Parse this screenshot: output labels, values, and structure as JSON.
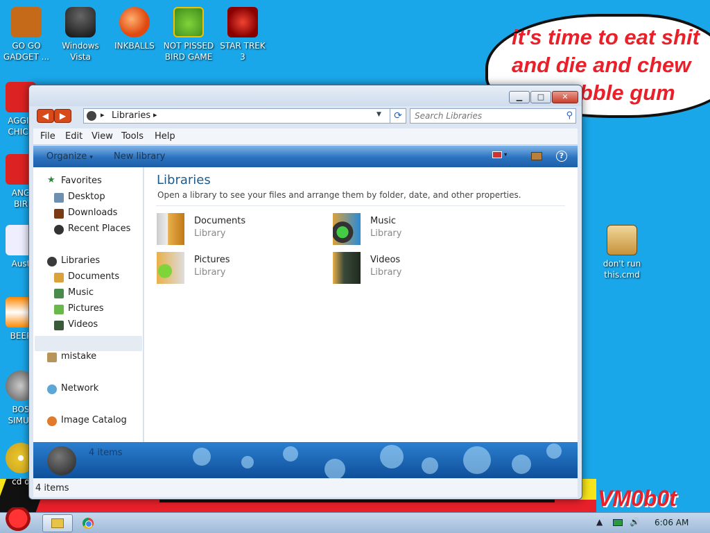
{
  "desktop": {
    "icons_top": [
      {
        "label_1": "GO GO",
        "label_2": "GADGET ...",
        "icon": "briefcase-icon",
        "color": "#c46a18"
      },
      {
        "label_1": "Windows",
        "label_2": "Vista",
        "icon": "trash-can-icon",
        "color": "#222222"
      },
      {
        "label_1": "INKBALLS",
        "label_2": "",
        "icon": "ink-ball-icon",
        "color": "#e85a12"
      },
      {
        "label_1": "NOT PISSED",
        "label_2": "BIRD GAME",
        "icon": "green-pig-icon",
        "color": "#6fb82f"
      },
      {
        "label_1": "STAR TREK",
        "label_2": "3",
        "icon": "star-wars-icon",
        "color": "#b2142a"
      }
    ],
    "icons_left": [
      {
        "label_1": "AGGIT",
        "label_2": "CHICK",
        "icon": "angry-bird-icon"
      },
      {
        "label_1": "ANG",
        "label_2": "BIR",
        "icon": "angry-bird-icon"
      },
      {
        "label_1": "Aust",
        "label_2": "",
        "icon": "cards-icon"
      },
      {
        "label_1": "BEEP",
        "label_2": "",
        "icon": "traffic-cone-icon"
      },
      {
        "label_1": "BOS",
        "label_2": "SIMUL",
        "icon": "spiky-ball-icon"
      },
      {
        "label_1": "cd d",
        "label_2": "",
        "icon": "cd-icon"
      }
    ],
    "cmd_icon": {
      "label_1": "don't run",
      "label_2": "this.cmd",
      "icon": "gear-script-icon"
    },
    "cloud_lines": [
      "it's time to eat shit",
      "and die and chew",
      "bubble gum"
    ],
    "watermark": "VM0b0t"
  },
  "window": {
    "caption": {
      "minimize": "▁",
      "maximize": "□",
      "close": "✕"
    },
    "address": {
      "path": "Libraries",
      "sep": "▸"
    },
    "search": {
      "placeholder": "Search Libraries"
    },
    "menu": [
      "File",
      "Edit",
      "View",
      "Tools",
      "Help"
    ],
    "commands": {
      "organize": "Organize",
      "organize_arrow": "▾",
      "new_library": "New library",
      "help": "?"
    },
    "nav": {
      "favorites": "Favorites",
      "desktop": "Desktop",
      "downloads": "Downloads",
      "recent": "Recent Places",
      "libraries": "Libraries",
      "documents": "Documents",
      "music": "Music",
      "pictures": "Pictures",
      "videos": "Videos",
      "mistake": "mistake",
      "network": "Network",
      "image_catalog": "Image Catalog"
    },
    "content": {
      "title": "Libraries",
      "description": "Open a library to see your files and arrange them by folder, date, and other properties.",
      "libraries": [
        {
          "name": "Documents",
          "kind": "Library"
        },
        {
          "name": "Music",
          "kind": "Library"
        },
        {
          "name": "Pictures",
          "kind": "Library"
        },
        {
          "name": "Videos",
          "kind": "Library"
        }
      ]
    },
    "details_count": "4 items",
    "status": "4 items"
  },
  "taskbar": {
    "clock": "6:06 AM",
    "tray_up": "▲",
    "volume": "🔊"
  }
}
